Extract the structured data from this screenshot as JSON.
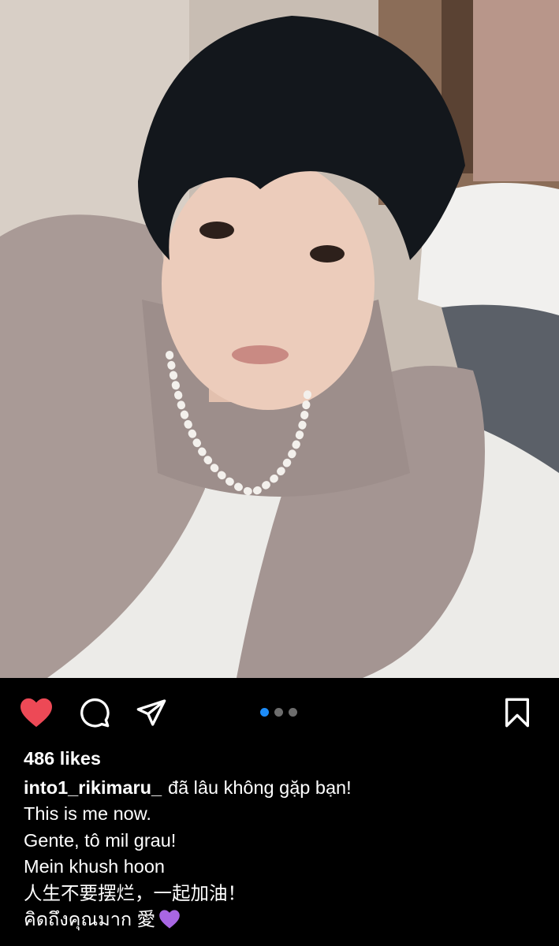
{
  "post": {
    "image": {
      "description_icon": "photo"
    },
    "actions": {
      "like_icon": "heart-filled-icon",
      "like_color": "#ed4956",
      "comment_icon": "comment-bubble-icon",
      "share_icon": "paper-plane-icon",
      "save_icon": "bookmark-icon",
      "carousel": {
        "total": 3,
        "active": 1,
        "active_color": "#1d8cf8"
      }
    },
    "likes": "486 likes",
    "caption": {
      "username": "into1_rikimaru_",
      "first_line": "đã lâu không gặp bạn!",
      "lines": [
        "This is me now.",
        "Gente, tô mil grau!",
        "Mein khush hoon",
        "人生不要摆烂，一起加油！"
      ],
      "last_line": "คิดถึงคุณมาก 愛",
      "last_emoji": "purple-heart-icon"
    }
  }
}
